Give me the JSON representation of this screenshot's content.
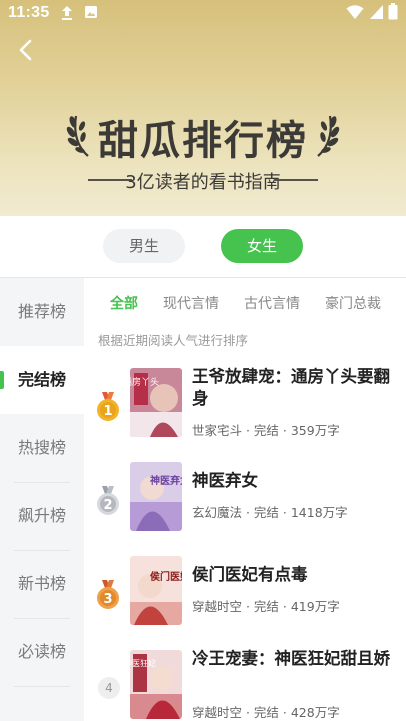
{
  "status_bar": {
    "time": "11:35"
  },
  "header": {
    "title": "甜瓜排行榜",
    "subtitle": "3亿读者的看书指南",
    "back_icon": "chevron-left-icon"
  },
  "gender_tabs": [
    {
      "label": "男生",
      "selected": false
    },
    {
      "label": "女生",
      "selected": true
    }
  ],
  "sidebar": {
    "items": [
      {
        "label": "推荐榜",
        "selected": false
      },
      {
        "label": "完结榜",
        "selected": true
      },
      {
        "label": "热搜榜",
        "selected": false
      },
      {
        "label": "飙升榜",
        "selected": false
      },
      {
        "label": "新书榜",
        "selected": false
      },
      {
        "label": "必读榜",
        "selected": false
      }
    ]
  },
  "category_tabs": [
    {
      "label": "全部",
      "selected": true
    },
    {
      "label": "现代言情",
      "selected": false
    },
    {
      "label": "古代言情",
      "selected": false
    },
    {
      "label": "豪门总裁",
      "selected": false
    }
  ],
  "hint": "根据近期阅读人气进行排序",
  "books": [
    {
      "rank": "1",
      "title": "王爷放肆宠：通房丫头要翻身",
      "meta": "世家宅斗 · 完结 · 359万字",
      "cover_text": "通房丫头",
      "cover_color": "#c9879a"
    },
    {
      "rank": "2",
      "title": "神医弃女",
      "meta": "玄幻魔法 · 完结 · 1418万字",
      "cover_text": "神医弃女",
      "cover_color": "#b79bd6"
    },
    {
      "rank": "3",
      "title": "侯门医妃有点毒",
      "meta": "穿越时空 · 完结 · 419万字",
      "cover_text": "侯门医妃",
      "cover_color": "#e6a9a2"
    },
    {
      "rank": "4",
      "title": "冷王宠妻：神医狂妃甜且娇",
      "meta": "穿越时空 · 完结 · 428万字",
      "cover_text": "神医狂妃",
      "cover_color": "#d98a8e"
    }
  ],
  "colors": {
    "accent": "#46c24e",
    "gold": "#e9a41d",
    "silver": "#b5b8bd",
    "bronze": "#e08a2c"
  }
}
